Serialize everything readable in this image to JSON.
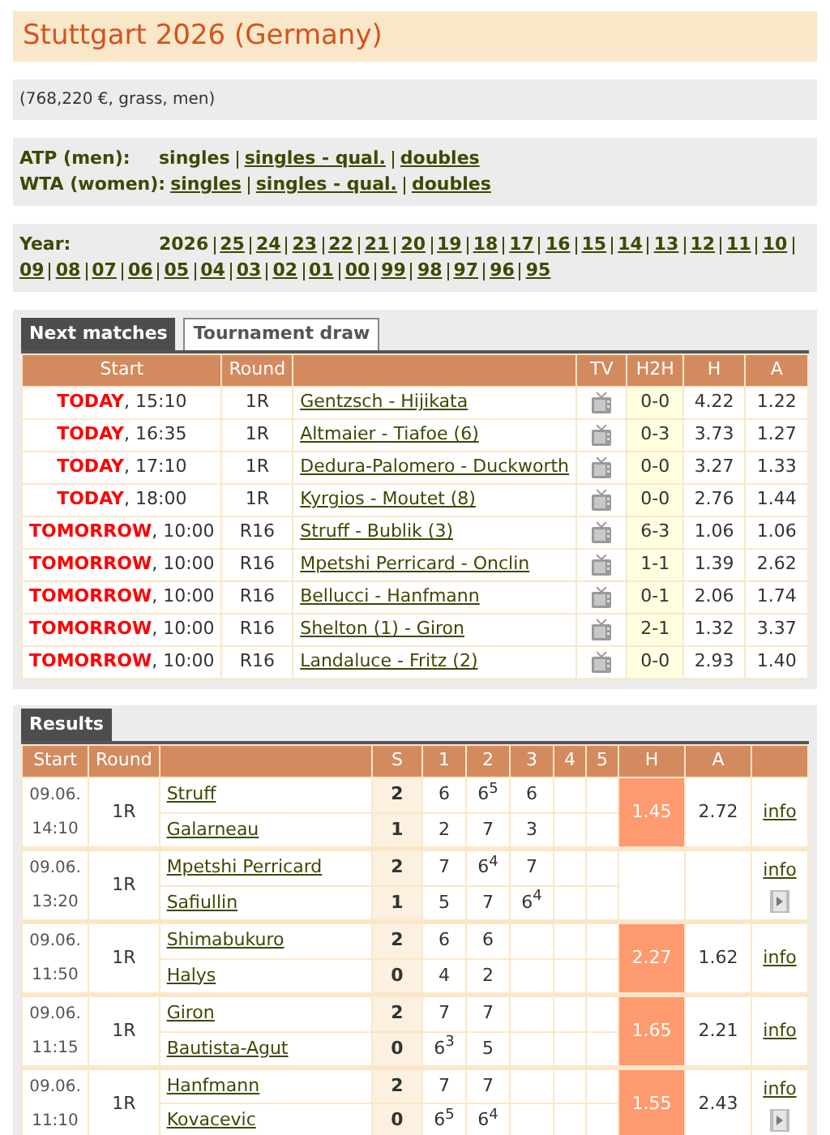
{
  "title": "Stuttgart 2026 (Germany)",
  "info": "(768,220 €, grass, men)",
  "categories": [
    {
      "label": "ATP (men):",
      "links": [
        {
          "text": "singles",
          "current": true
        },
        {
          "text": "singles - qual.",
          "current": false
        },
        {
          "text": "doubles",
          "current": false
        }
      ]
    },
    {
      "label": "WTA (women):",
      "links": [
        {
          "text": "singles",
          "current": false
        },
        {
          "text": "singles - qual.",
          "current": false
        },
        {
          "text": "doubles",
          "current": false
        }
      ]
    }
  ],
  "year": {
    "label": "Year:",
    "items": [
      {
        "text": "2026",
        "current": true
      },
      {
        "text": "25",
        "current": false
      },
      {
        "text": "24",
        "current": false
      },
      {
        "text": "23",
        "current": false
      },
      {
        "text": "22",
        "current": false
      },
      {
        "text": "21",
        "current": false
      },
      {
        "text": "20",
        "current": false
      },
      {
        "text": "19",
        "current": false
      },
      {
        "text": "18",
        "current": false
      },
      {
        "text": "17",
        "current": false
      },
      {
        "text": "16",
        "current": false
      },
      {
        "text": "15",
        "current": false
      },
      {
        "text": "14",
        "current": false
      },
      {
        "text": "13",
        "current": false
      },
      {
        "text": "12",
        "current": false
      },
      {
        "text": "11",
        "current": false
      },
      {
        "text": "10",
        "current": false
      },
      {
        "text": "09",
        "current": false
      },
      {
        "text": "08",
        "current": false
      },
      {
        "text": "07",
        "current": false
      },
      {
        "text": "06",
        "current": false
      },
      {
        "text": "05",
        "current": false
      },
      {
        "text": "04",
        "current": false
      },
      {
        "text": "03",
        "current": false
      },
      {
        "text": "02",
        "current": false
      },
      {
        "text": "01",
        "current": false
      },
      {
        "text": "00",
        "current": false
      },
      {
        "text": "99",
        "current": false
      },
      {
        "text": "98",
        "current": false
      },
      {
        "text": "97",
        "current": false
      },
      {
        "text": "96",
        "current": false
      },
      {
        "text": "95",
        "current": false
      }
    ]
  },
  "tabs": [
    {
      "label": "Next matches",
      "selected": true
    },
    {
      "label": "Tournament draw",
      "selected": false
    }
  ],
  "next_matches": {
    "columns": {
      "start": "Start",
      "round": "Round",
      "tv": "TV",
      "h2h": "H2H",
      "home": "H",
      "away": "A"
    },
    "rows": [
      {
        "day": "TODAY",
        "time": ", 15:10",
        "round": "1R",
        "match": "Gentzsch - Hijikata",
        "h2h": "0-0",
        "h": "4.22",
        "a": "1.22"
      },
      {
        "day": "TODAY",
        "time": ", 16:35",
        "round": "1R",
        "match": "Altmaier - Tiafoe (6)",
        "h2h": "0-3",
        "h": "3.73",
        "a": "1.27"
      },
      {
        "day": "TODAY",
        "time": ", 17:10",
        "round": "1R",
        "match": "Dedura-Palomero - Duckworth",
        "h2h": "0-0",
        "h": "3.27",
        "a": "1.33"
      },
      {
        "day": "TODAY",
        "time": ", 18:00",
        "round": "1R",
        "match": "Kyrgios - Moutet (8)",
        "h2h": "0-0",
        "h": "2.76",
        "a": "1.44"
      },
      {
        "day": "TOMORROW",
        "time": ", 10:00",
        "round": "R16",
        "match": "Struff - Bublik (3)",
        "h2h": "6-3",
        "h": "1.06",
        "a": "1.06"
      },
      {
        "day": "TOMORROW",
        "time": ", 10:00",
        "round": "R16",
        "match": "Mpetshi Perricard - Onclin",
        "h2h": "1-1",
        "h": "1.39",
        "a": "2.62"
      },
      {
        "day": "TOMORROW",
        "time": ", 10:00",
        "round": "R16",
        "match": "Bellucci - Hanfmann",
        "h2h": "0-1",
        "h": "2.06",
        "a": "1.74"
      },
      {
        "day": "TOMORROW",
        "time": ", 10:00",
        "round": "R16",
        "match": "Shelton (1) - Giron",
        "h2h": "2-1",
        "h": "1.32",
        "a": "3.37"
      },
      {
        "day": "TOMORROW",
        "time": ", 10:00",
        "round": "R16",
        "match": "Landaluce - Fritz (2)",
        "h2h": "0-0",
        "h": "2.93",
        "a": "1.40"
      }
    ]
  },
  "results": {
    "tab": "Results",
    "columns": {
      "start": "Start",
      "round": "Round",
      "sets": "S",
      "set_numbers": [
        "1",
        "2",
        "3",
        "4",
        "5"
      ],
      "home": "H",
      "away": "A"
    },
    "rows": [
      {
        "date": "09.06.",
        "time": "14:10",
        "round": "1R",
        "players": [
          {
            "name": "Struff",
            "sets": "2",
            "scores": [
              "6",
              "6$^{5}$",
              "6"
            ]
          },
          {
            "name": "Galarneau",
            "sets": "1",
            "scores": [
              "2",
              "7",
              "3"
            ]
          }
        ],
        "h": "1.45",
        "a": "2.72",
        "h_highlight": true,
        "info": "info",
        "video": false
      },
      {
        "date": "09.06.",
        "time": "13:20",
        "round": "1R",
        "players": [
          {
            "name": "Mpetshi Perricard",
            "sets": "2",
            "scores": [
              "7",
              "6$^{4}$",
              "7"
            ]
          },
          {
            "name": "Safiullin",
            "sets": "1",
            "scores": [
              "5",
              "7",
              "6$^{4}$"
            ]
          }
        ],
        "h_highlight": false,
        "info": "info",
        "video": true
      },
      {
        "date": "09.06.",
        "time": "11:50",
        "round": "1R",
        "players": [
          {
            "name": "Shimabukuro",
            "sets": "2",
            "scores": [
              "6",
              "6"
            ]
          },
          {
            "name": "Halys",
            "sets": "0",
            "scores": [
              "4",
              "2"
            ]
          }
        ],
        "h": "2.27",
        "a": "1.62",
        "h_highlight": true,
        "info": "info",
        "video": false
      },
      {
        "date": "09.06.",
        "time": "11:15",
        "round": "1R",
        "players": [
          {
            "name": "Giron",
            "sets": "2",
            "scores": [
              "7",
              "7"
            ]
          },
          {
            "name": "Bautista-Agut",
            "sets": "0",
            "scores": [
              "6$^{3}$",
              "5"
            ]
          }
        ],
        "h": "1.65",
        "a": "2.21",
        "h_highlight": true,
        "info": "info",
        "video": false
      },
      {
        "date": "09.06.",
        "time": "11:10",
        "round": "1R",
        "players": [
          {
            "name": "Hanfmann",
            "sets": "2",
            "scores": [
              "7",
              "7"
            ]
          },
          {
            "name": "Kovacevic",
            "sets": "0",
            "scores": [
              "6$^{5}$",
              "6$^{4}$"
            ]
          }
        ],
        "h": "1.55",
        "a": "2.43",
        "h_highlight": true,
        "info": "info",
        "video": true
      }
    ]
  }
}
